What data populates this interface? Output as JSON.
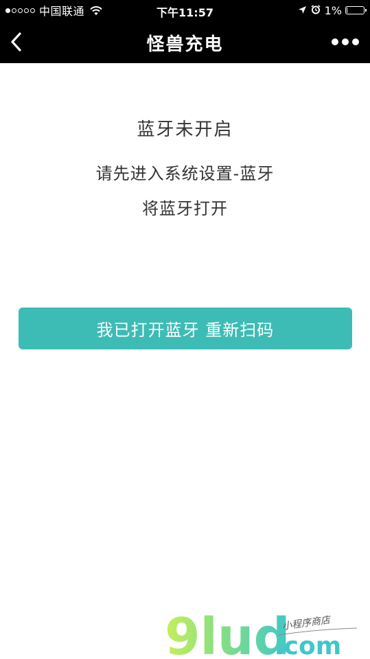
{
  "status_bar": {
    "carrier": "中国联通",
    "signal_bars_filled": 1,
    "signal_bars_total": 5,
    "time": "下午11:57",
    "battery": "1%",
    "battery_level": 0.01
  },
  "nav": {
    "title": "怪兽充电",
    "back_icon": "chevron-left-icon",
    "more_icon": "more-dots-icon"
  },
  "message": {
    "title": "蓝牙未开启",
    "line1": "请先进入系统设置-蓝牙",
    "line2": "将蓝牙打开"
  },
  "action": {
    "button_label": "我已打开蓝牙 重新扫码"
  },
  "watermark": {
    "logo_text": "9lud",
    "domain": ".com",
    "tagline": "小程序商店"
  },
  "colors": {
    "bar_background": "#000000",
    "accent": "#3dbcb5",
    "text": "#333333"
  }
}
